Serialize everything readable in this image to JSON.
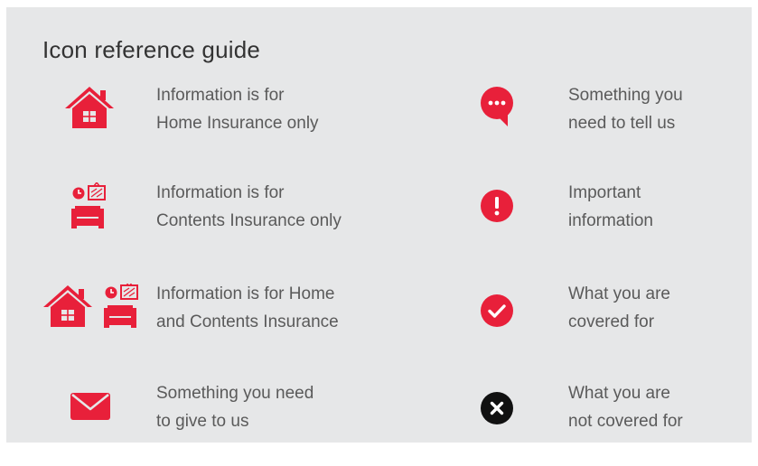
{
  "guide": {
    "title": "Icon reference guide",
    "colors": {
      "accent": "#e8203a",
      "dark": "#111111",
      "background": "#e6e7e8",
      "text": "#5a5a5a"
    },
    "items": [
      {
        "icon": "house-icon",
        "line1": "Information is for",
        "line2": "Home Insurance only"
      },
      {
        "icon": "speech-bubble-icon",
        "line1": "Something you",
        "line2": "need to tell us"
      },
      {
        "icon": "sofa-contents-icon",
        "line1": "Information is for",
        "line2": "Contents Insurance only"
      },
      {
        "icon": "exclamation-icon",
        "line1": "Important",
        "line2": "information"
      },
      {
        "icon": "house-and-sofa-icon",
        "line1": "Information is for Home",
        "line2": "and Contents Insurance"
      },
      {
        "icon": "checkmark-icon",
        "line1": "What you are",
        "line2": "covered for"
      },
      {
        "icon": "envelope-icon",
        "line1": "Something you need",
        "line2": "to give to us"
      },
      {
        "icon": "cross-icon",
        "line1": "What you are",
        "line2": "not covered for"
      }
    ]
  }
}
